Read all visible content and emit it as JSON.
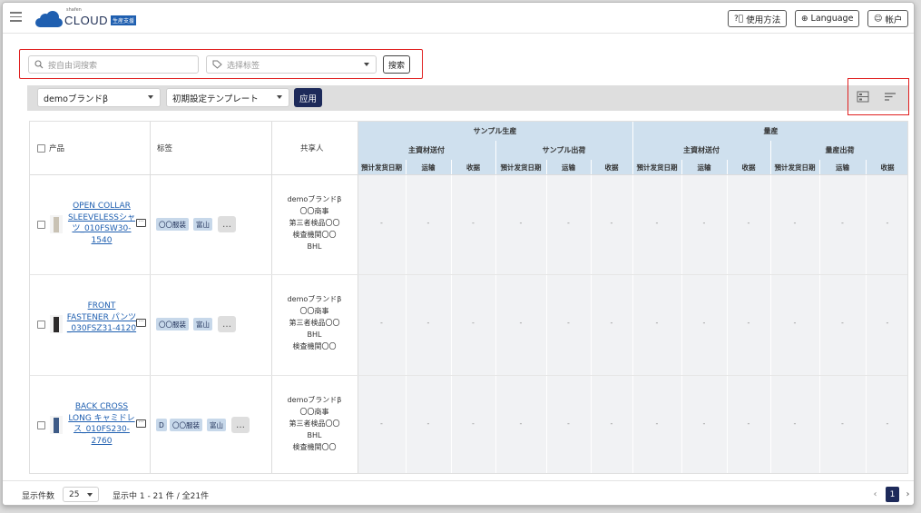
{
  "header": {
    "logo_small": "shafen",
    "logo_main": "CLOUD",
    "logo_tag": "生産支援",
    "help_label": "使用方法",
    "language_label": "Language",
    "account_label": "帐户"
  },
  "filters": {
    "search_placeholder": "按自由词搜索",
    "tag_placeholder": "选择标签",
    "search_button": "搜索"
  },
  "toolbar": {
    "brand_select": "demoブランドβ",
    "template_select": "初期設定テンプレート",
    "apply_button": "应用"
  },
  "table": {
    "col_product": "产品",
    "col_tags": "标签",
    "col_shared": "共享人",
    "group_sample": "サンプル生産",
    "group_mass": "量産",
    "sub_main_material_1": "主資材送付",
    "sub_sample_ship": "サンプル出荷",
    "sub_main_material_2": "主資材送付",
    "sub_mass_ship": "量産出荷",
    "leaf_headers": [
      "預计发货日期",
      "运输",
      "收据",
      "預计发货日期",
      "运输",
      "收据",
      "預计发货日期",
      "运输",
      "收据",
      "預计发货日期",
      "运输",
      "收据"
    ],
    "empty": "-",
    "rows": [
      {
        "product": "OPEN COLLAR SLEEVELESSシャツ_010FSW30-1540",
        "tags": [
          "〇〇服装",
          "富山"
        ],
        "more": "…",
        "shared": [
          "demoブランドβ",
          "〇〇商事",
          "第三者検品〇〇",
          "検査機関〇〇",
          "BHL"
        ],
        "thumb_color": "#c9c2b4"
      },
      {
        "product": "FRONT FASTENER パンツ_030FSZ31-4120",
        "tags": [
          "〇〇服装",
          "富山"
        ],
        "more": "…",
        "shared": [
          "demoブランドβ",
          "〇〇商事",
          "第三者検品〇〇",
          "BHL",
          "検査機関〇〇"
        ],
        "thumb_color": "#2c2a2a"
      },
      {
        "product": "BACK CROSS LONG キャミドレス_010FS230-2760",
        "tags": [
          "D",
          "〇〇服装",
          "富山"
        ],
        "more": "…",
        "shared": [
          "demoブランドβ",
          "〇〇商事",
          "第三者検品〇〇",
          "BHL",
          "検査機関〇〇"
        ],
        "thumb_color": "#3d5a86"
      }
    ]
  },
  "footer": {
    "per_page_label": "显示件数",
    "per_page_value": "25",
    "range_text": "显示中 1 - 21 件 / 全21件",
    "current_page": "1",
    "prev": "‹",
    "next": "›"
  }
}
